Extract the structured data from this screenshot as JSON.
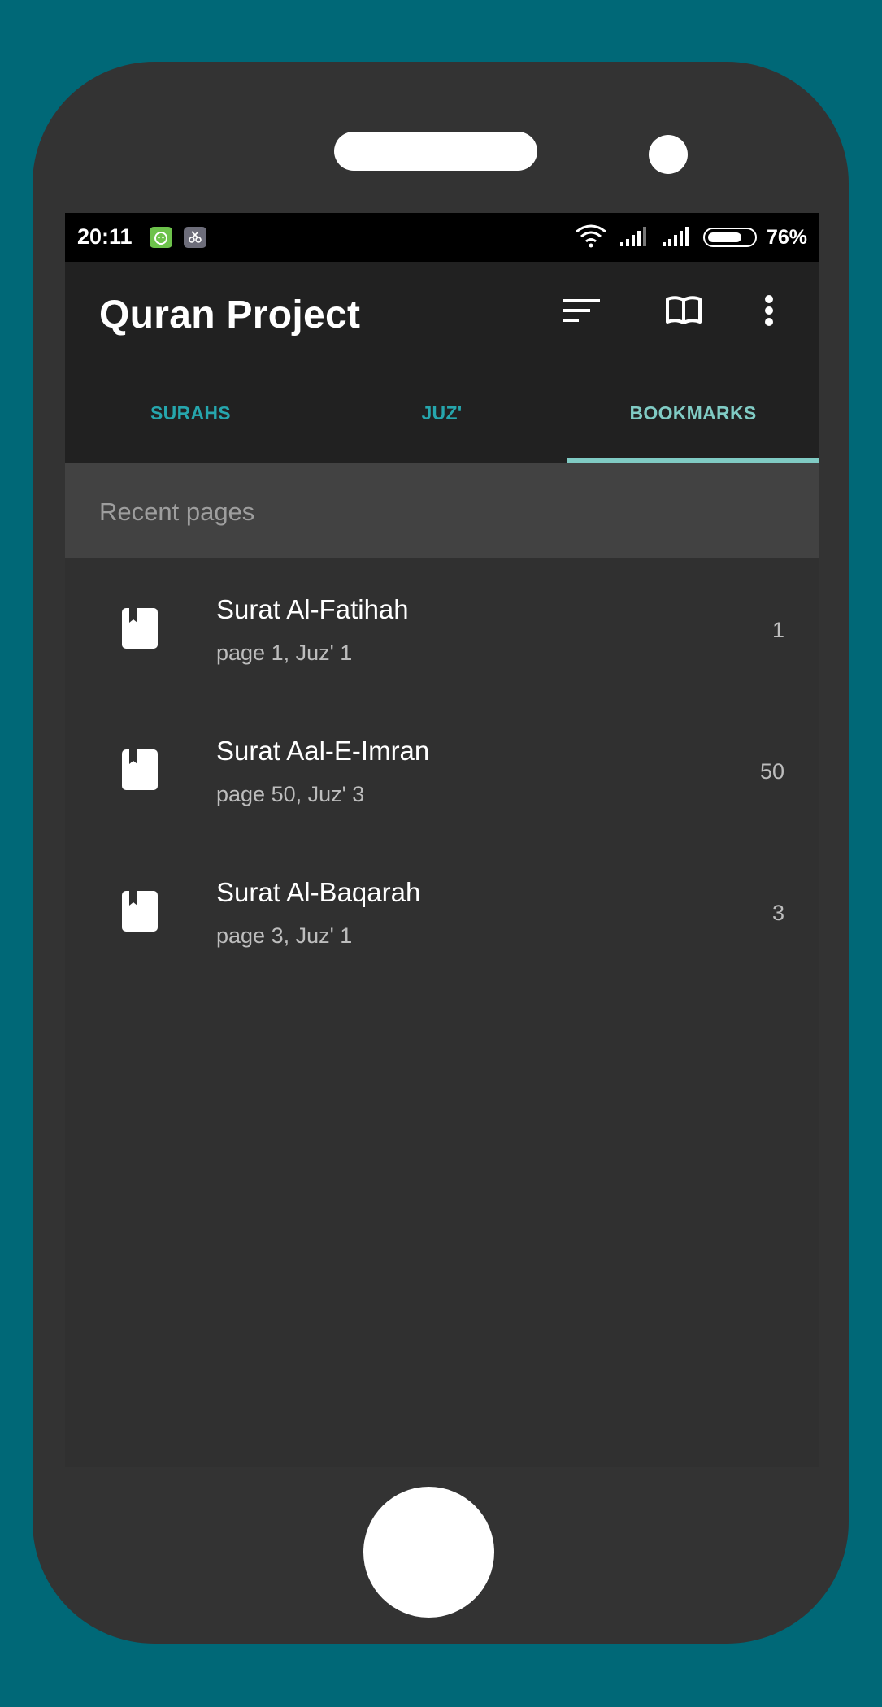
{
  "status_bar": {
    "time": "20:11",
    "battery_percent": "76%",
    "battery_level": 0.76,
    "icons": [
      "wifi-icon",
      "signal-icon",
      "signal-icon",
      "battery-icon"
    ]
  },
  "app": {
    "title": "Quran Project",
    "actions": [
      "sort-icon",
      "book-open-icon",
      "more-vert-icon"
    ]
  },
  "tabs": [
    {
      "label": "SURAHS",
      "active": false
    },
    {
      "label": "JUZ'",
      "active": false
    },
    {
      "label": "BOOKMARKS",
      "active": true
    }
  ],
  "colors": {
    "accent": "#80cbc4",
    "tab_inactive": "#26a6ad",
    "background": "#006877"
  },
  "section": {
    "header": "Recent pages"
  },
  "recent_pages": [
    {
      "title": "Surat Al-Fatihah",
      "subtitle": "page 1, Juz' 1",
      "page": "1"
    },
    {
      "title": "Surat Aal-E-Imran",
      "subtitle": "page 50, Juz' 3",
      "page": "50"
    },
    {
      "title": "Surat Al-Baqarah",
      "subtitle": "page 3, Juz' 1",
      "page": "3"
    }
  ]
}
